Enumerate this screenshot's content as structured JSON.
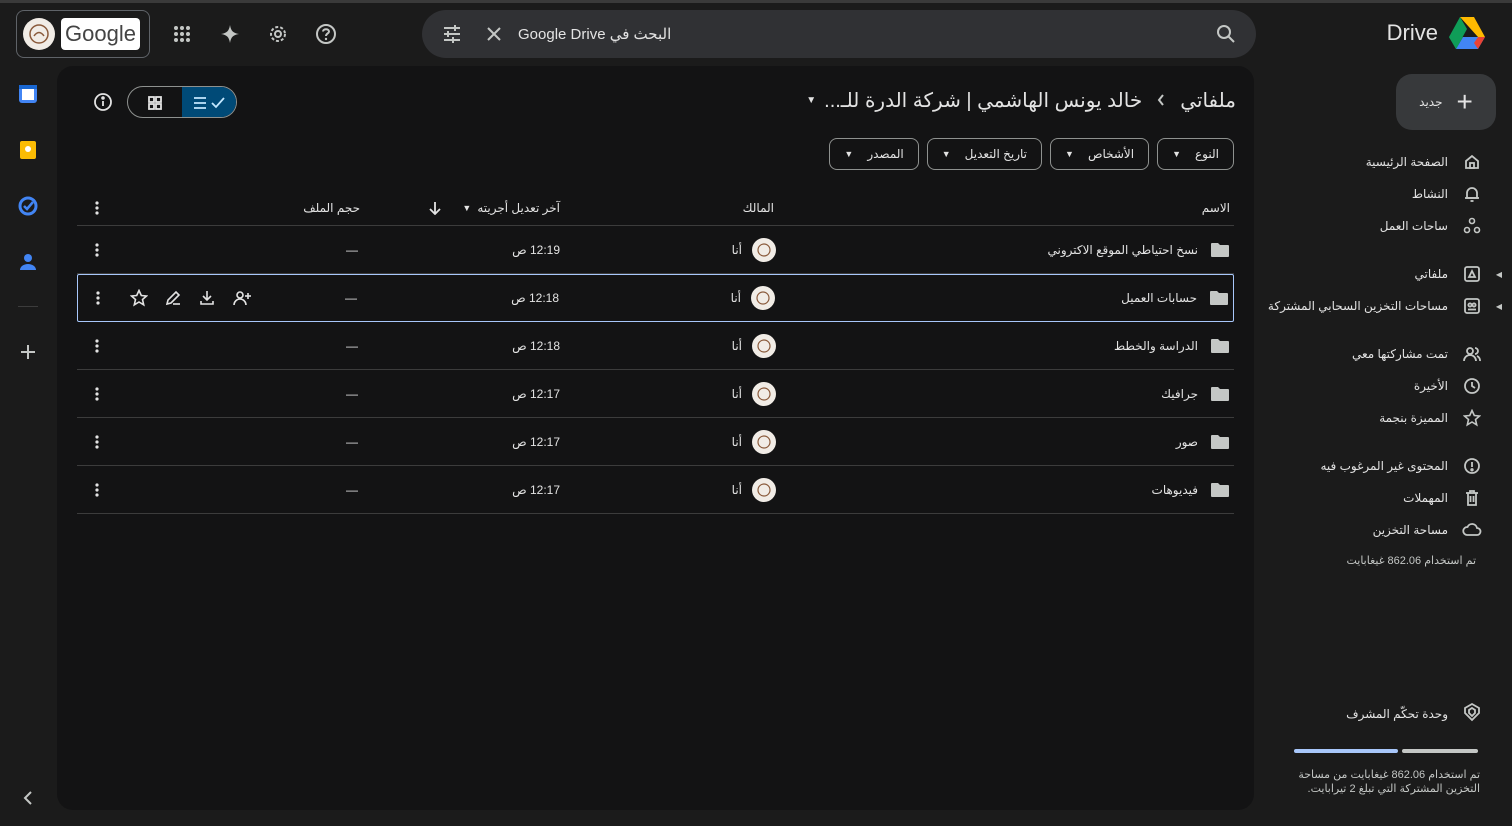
{
  "app": {
    "name": "Drive",
    "colors": {
      "accent": "#a8c7fa",
      "selected_toggle": "#004a77",
      "background": "#131314"
    }
  },
  "topbar": {
    "google_label": "Google",
    "search_placeholder": "البحث في Google Drive",
    "icons": [
      "apps-icon",
      "gemini-icon",
      "settings-icon",
      "help-icon",
      "search-options-icon",
      "clear-icon",
      "search-icon"
    ]
  },
  "sidebar": {
    "new_label": "جديد",
    "items": [
      {
        "label": "الصفحة الرئيسية",
        "icon": "home-icon"
      },
      {
        "label": "النشاط",
        "icon": "bell-icon"
      },
      {
        "label": "ساحات العمل",
        "icon": "workspaces-icon"
      },
      {
        "label": "ملفاتي",
        "icon": "my-drive-icon"
      },
      {
        "label": "مساحات التخزين السحابي المشتركة",
        "icon": "shared-drives-icon"
      },
      {
        "label": "تمت مشاركتها معي",
        "icon": "shared-with-me-icon"
      },
      {
        "label": "الأخيرة",
        "icon": "clock-icon"
      },
      {
        "label": "المميزة بنجمة",
        "icon": "star-icon"
      },
      {
        "label": "المحتوى غير المرغوب فيه",
        "icon": "spam-icon"
      },
      {
        "label": "المهملات",
        "icon": "trash-icon"
      },
      {
        "label": "مساحة التخزين",
        "icon": "cloud-icon"
      }
    ],
    "storage_used": "تم استخدام 862.06 غيغابايت",
    "admin_label": "وحدة تحكّم المشرف",
    "storage_usage_fraction": 0.42,
    "storage_note": "تم استخدام 862.06 غيغابايت من مساحة التخزين المشتركة التي تبلغ 2 تيرابايت."
  },
  "main": {
    "breadcrumb": {
      "root": "ملفاتي",
      "current": "خالد يونس الهاشمي | شركة الدرة للـ..."
    },
    "filters": [
      "النوع",
      "الأشخاص",
      "تاريخ التعديل",
      "المصدر"
    ],
    "columns": {
      "name": "الاسم",
      "owner": "المالك",
      "modified": "آخر تعديل أجريته",
      "size": "حجم الملف"
    },
    "rows": [
      {
        "name": "نسخ احتياطي الموقع الاكتروني",
        "owner": "أنا",
        "modified": "12:19 ص",
        "size": "—"
      },
      {
        "name": "حسابات العميل",
        "owner": "أنا",
        "modified": "12:18 ص",
        "size": "—"
      },
      {
        "name": "الدراسة والخطط",
        "owner": "أنا",
        "modified": "12:18 ص",
        "size": "—"
      },
      {
        "name": "جرافيك",
        "owner": "أنا",
        "modified": "12:17 ص",
        "size": "—"
      },
      {
        "name": "صور",
        "owner": "أنا",
        "modified": "12:17 ص",
        "size": "—"
      },
      {
        "name": "فيديوهات",
        "owner": "أنا",
        "modified": "12:17 ص",
        "size": "—"
      }
    ]
  }
}
